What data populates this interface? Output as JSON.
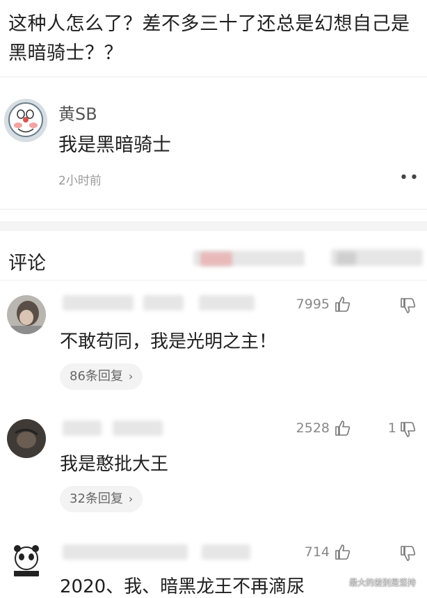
{
  "question": {
    "title": "这种人怎么了？差不多三十了还总是幻想自己是黑暗骑士？？"
  },
  "answer": {
    "author": "黄SB",
    "text": "我是黑暗骑士",
    "time": "2小时前",
    "more_icon": "more-dots-icon"
  },
  "comments_section": {
    "title": "评论"
  },
  "comments": [
    {
      "text": "不敢苟同，我是光明之主！",
      "likes": "7995",
      "dislikes": "",
      "replies": "86条回复"
    },
    {
      "text": "我是憨批大王",
      "likes": "2528",
      "dislikes": "1",
      "replies": "32条回复"
    },
    {
      "text": "2020、我、暗黑龙王不再滴尿",
      "likes": "714",
      "dislikes": "",
      "replies": ""
    }
  ],
  "watermark": "最大的差别是坚持"
}
